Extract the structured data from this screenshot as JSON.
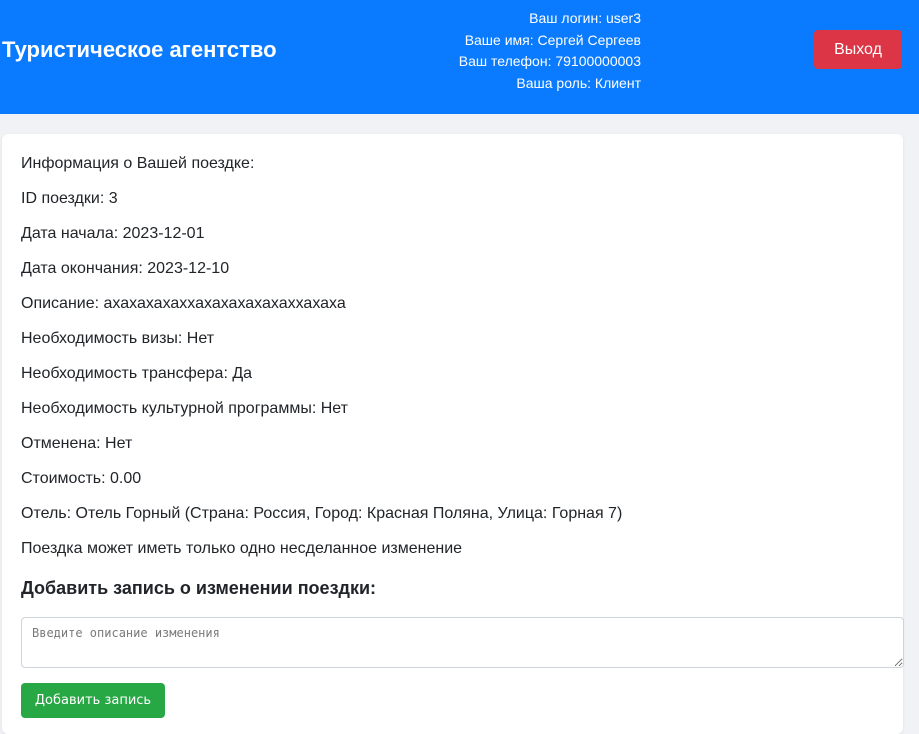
{
  "header": {
    "title": "Туристическое агентство",
    "login_line": "Ваш логин: user3",
    "name_line": "Ваше имя: Сергей Сергеев",
    "phone_line": "Ваш телефон: 79100000003",
    "role_line": "Ваша роль: Клиент",
    "logout_label": "Выход"
  },
  "trip": {
    "heading": "Информация о Вашей поездке:",
    "id": "ID поездки: 3",
    "start_date": "Дата начала: 2023-12-01",
    "end_date": "Дата окончания: 2023-12-10",
    "description": "Описание: ахахахахаххахахахахахаххахаха",
    "visa": "Необходимость визы: Нет",
    "transfer": "Необходимость трансфера: Да",
    "cultural_program": "Необходимость культурной программы: Нет",
    "cancelled": "Отменена: Нет",
    "cost": "Стоимость: 0.00",
    "hotel": "Отель: Отель Горный (Страна: Россия, Город: Красная Поляна, Улица: Горная 7)",
    "change_notice": "Поездка может иметь только одно несделанное изменение"
  },
  "change_form": {
    "title": "Добавить запись о изменении поездки:",
    "placeholder": "Введите описание изменения",
    "value": "",
    "submit_label": "Добавить запись"
  },
  "colors": {
    "header_bg": "#0a7bff",
    "logout_bg": "#dc3545",
    "add_bg": "#28a745",
    "page_bg": "#f0f2f5"
  }
}
